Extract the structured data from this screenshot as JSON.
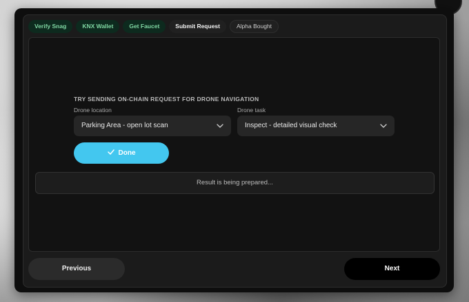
{
  "steps": [
    {
      "label": "Verify Snag",
      "state": "done"
    },
    {
      "label": "KNX Wallet",
      "state": "done"
    },
    {
      "label": "Get Faucet",
      "state": "done"
    },
    {
      "label": "Submit Request",
      "state": "current"
    },
    {
      "label": "Alpha Bought",
      "state": "pending"
    }
  ],
  "form": {
    "title": "TRY SENDING ON-CHAIN REQUEST FOR DRONE NAVIGATION",
    "location_label": "Drone location",
    "location_value": "Parking Area - open lot scan",
    "task_label": "Drone task",
    "task_value": "Inspect - detailed visual check",
    "done_label": "Done",
    "done_icon": "check-icon"
  },
  "result": {
    "text": "Result is being prepared..."
  },
  "nav": {
    "previous_label": "Previous",
    "next_label": "Next"
  },
  "colors": {
    "accent": "#43c7ef",
    "step_done_bg": "#0d2a1e",
    "step_done_text": "#7fd6a2"
  }
}
